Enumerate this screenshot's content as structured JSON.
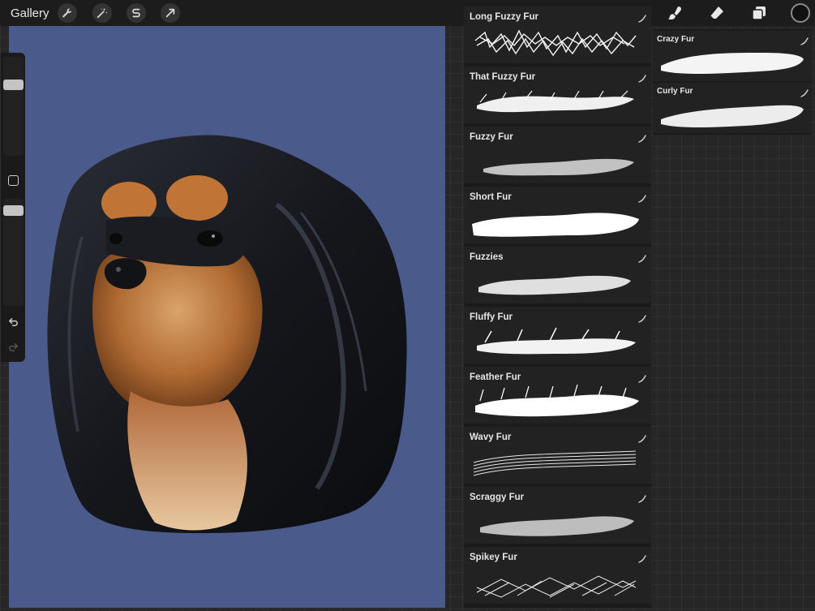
{
  "topbar": {
    "gallery_label": "Gallery",
    "tools": [
      "wrench-icon",
      "magic-wand-icon",
      "selection-s-icon",
      "transform-arrow-icon"
    ],
    "right_tools": [
      "brush-icon",
      "eraser-icon",
      "layers-icon"
    ],
    "current_color": "#111111"
  },
  "sidebar": {
    "brush_size_slider": "size",
    "opacity_slider": "opacity"
  },
  "brushes": [
    {
      "name": "Long Fuzzy Fur"
    },
    {
      "name": "That Fuzzy Fur"
    },
    {
      "name": "Fuzzy Fur"
    },
    {
      "name": "Short Fur"
    },
    {
      "name": "Fuzzies"
    },
    {
      "name": "Fluffy Fur"
    },
    {
      "name": "Feather Fur"
    },
    {
      "name": "Wavy Fur"
    },
    {
      "name": "Scraggy Fur"
    },
    {
      "name": "Spikey Fur"
    }
  ],
  "brush_sets": [
    {
      "name": "Crazy Fur"
    },
    {
      "name": "Curly Fur"
    }
  ],
  "canvas": {
    "background_color": "#4a5a8b"
  }
}
